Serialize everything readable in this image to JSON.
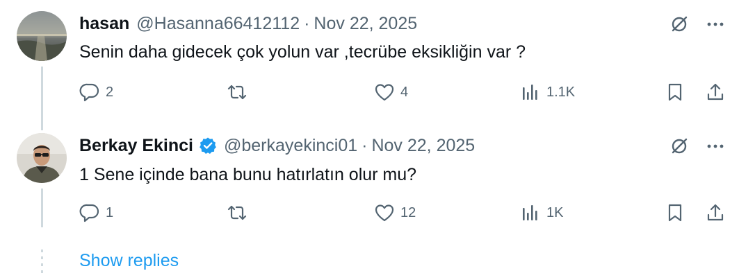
{
  "replies": [
    {
      "name": "hasan",
      "handle": "@Hasanna66412112",
      "separator": "·",
      "date": "Nov 22, 2025",
      "verified": false,
      "text": "Senin daha gidecek çok yolun var ,tecrübe eksikliğin var ?",
      "reply_count": "2",
      "retweet_count": "",
      "like_count": "4",
      "view_count": "1.1K",
      "avatar_icon": "avatar-sea-photo"
    },
    {
      "name": "Berkay Ekinci",
      "handle": "@berkayekinci01",
      "separator": "·",
      "date": "Nov 22, 2025",
      "verified": true,
      "text": "1 Sene içinde bana bunu hatırlatın olur mu?",
      "reply_count": "1",
      "retweet_count": "",
      "like_count": "12",
      "view_count": "1K",
      "avatar_icon": "avatar-person-photo"
    }
  ],
  "show_replies_label": "Show replies",
  "colors": {
    "text_primary": "#0f1419",
    "text_secondary": "#536471",
    "accent_blue": "#1d9bf0",
    "thread_line": "#cfd9de"
  },
  "icons": [
    "grok-icon",
    "more-icon",
    "reply-icon",
    "retweet-icon",
    "like-icon",
    "views-icon",
    "bookmark-icon",
    "share-icon",
    "verified-badge-icon"
  ]
}
